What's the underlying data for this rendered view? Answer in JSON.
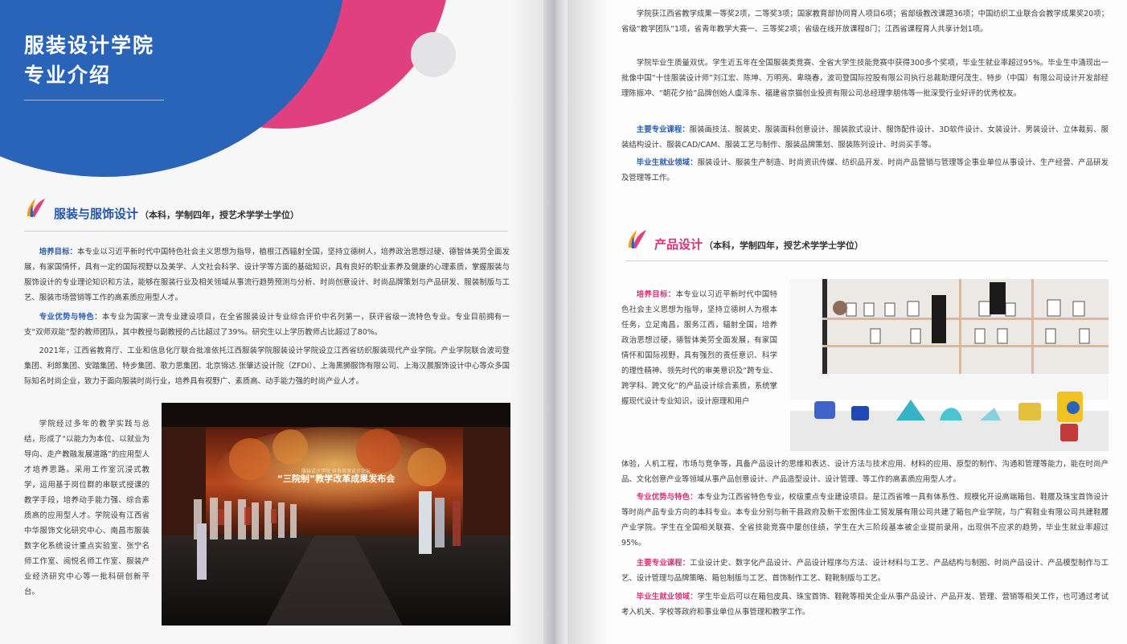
{
  "header": {
    "line1": "服装设计学院",
    "line2": "专业介绍"
  },
  "fashion": {
    "title": "服装与服饰设计",
    "subtitle": "（本科，学制四年，授艺术学学士学位）",
    "p1_label": "培养目标：",
    "p1": "本专业以习近平新时代中国特色社会主义思想为指导，植根江西辐射全国，坚持立德树人，培养政治思想过硬、德智体美劳全面发展，有家国情怀，具有一定的国际视野以及美学、人文社会科学、设计学等方面的基础知识，具有良好的职业素养及健康的心理素质，掌握服装与服饰设计的专业理论知识和方法，能够在服装行业及相关领域从事流行趋势预测与分析、时尚创意设计、时尚品牌策划与产品研发、服装制版与工艺、服装市场营销等工作的高素质应用型人才。",
    "p2_label": "专业优势与特色：",
    "p2": "本专业为国家一流专业建设项目，在全省服装设计专业综合评价中名列第一，获评省级一流特色专业。专业目前拥有一支“双师双能”型的教师团队，其中教授与副教授的占比超过了39%。研究生以上学历教师占比超过了80%。",
    "p3": "2021年，江西省教育厅、工业和信息化厅联合批准依托江西服装学院服装设计学院设立江西省纺织服装现代产业学院。产业学院联合波司登集团、利郎集团、安踏集团、特步集团、歌力思集团、北京锦达.张肇达设计院（ZFDI）、上海黑狮服饰有限公司、上海汉晨服饰设计中心等众多国际知名时尚企业，致力于面向服装时尚行业，培养具有视野广、素质高、动手能力强的时尚产业人才。",
    "p4": "学院经过多年的教学实践与总结，形成了“以能力为本位、以就业为导向、走产教融发展道路”的应用型人才培养思路。采用工作室沉浸式教学，运用基于岗位群的串联式授课的教学手段，培养动手能力强、综合素质高的应用型人才。学院设有江西省中华服饰文化研究中心、南昌市服装数字化系统设计重点实验室、张宁名师工作室、阅悦名师工作室、服装产业经济研究中心等一批科研创新平台。",
    "photo_banner_small": "服装设计学院  财务首席设计论坛",
    "photo_banner": "“三院制”教学改革成果发布会"
  },
  "right_top": {
    "p1": "学院获江西省教学成果一等奖2项，二等奖3项；国家教育部协同育人项目6项；省部级教改课题36项；中国纺织工业联合会教学成果奖20项；省级“教学团队”1项，省青年教学大赛一、三等奖2项；省级在线开放课程8门；江西省课程育人共享计划1项。",
    "p2": "学院毕业生质量双优。学生近五年在全国服装类竞赛、全省大学生技能竞赛中获得300多个奖项，毕业生就业率超过95%。毕业生中涌现出一批像中国“十佳服装设计师”刘江宏、陈坤、万明亮、卑晓春，波司登国际控股有限公司执行总裁助理何茂生、特步（中国）有限公司设计开发部经理陈振冲、“朝花夕拾”品牌创始人虞泽东、福建省京猫创业投资有限公司总经理李朋伟等一批深受行业好评的优秀校友。",
    "p3_label": "主要专业课程：",
    "p3": "服装画技法、服装史、服装面料创意设计、服装款式设计、服饰配件设计、3D软件设计、女装设计、男装设计、立体裁剪、服装结构设计、服装CAD/CAM、服装工艺与制作、服装品牌策划、服装陈列设计、时尚买手等。",
    "p4_label": "毕业生就业领域：",
    "p4": "服装设计、服装生产制造、时尚资讯传媒、纺织品开发、时尚产品营销与管理等企事业单位从事设计、生产经营、产品研发及管理等工作。"
  },
  "product": {
    "title": "产品设计",
    "subtitle": "（本科，学制四年，授艺术学学士学位）",
    "p1_label": "培养目标：",
    "p1_side": "本专业以习近平新时代中国特色社会主义思想为指导，坚持立德树人为根本任务，立足南昌，服务江西，辐射全国，培养政治思想过硬，德智体美劳全面发展，有家国情怀和国际视野，具有强烈的责任意识、科学的理性精神、领先时代的审美意识及“跨专业、跨学科、跨文化”的产品设计综合素质，系统掌握现代设计专业知识，设计原理和用户",
    "p1_rest": "体验，人机工程，市场与竞争等，具备产品设计的思维和表达、设计方法与技术应用、材料的应用、原型的制作、沟通和管理等能力，能在时尚产品、文化创意产业等领域从事产品创意设计、产品造型设计、设计管理、等工作的高素质应用型人才。",
    "p2_label": "专业优势与特色：",
    "p2": "本专业为江西省特色专业，校级重点专业建设项目。是江西省唯一具有体系性、规模化开设高端箱包、鞋履及珠宝首饰设计等时尚产品专业方向的本科专业。本专业分别与新干县政府及新干宏图伟业工贸发展有限公司共建了箱包产业学院，与广宥鞋业有限公司共建鞋履产业学院。学生在全国相关联赛、全省技能竞赛中屡创佳绩，学生在大三阶段基本被企业提前录用，出现供不应求的趋势，毕业生就业率超过95%。",
    "p3_label": "主要专业课程：",
    "p3": "工业设计史、数字化产品设计、产品设计程序与方法、设计材料与工艺、产品结构与制图、时尚产品设计、产品模型制作与工艺、设计管理与品牌策略、箱包制版与工艺、首饰制作工艺、鞋靴制版与工艺。",
    "p4_label": "毕业生就业领域：",
    "p4": "学生毕业后可以在箱包皮具、珠宝首饰、鞋靴等相关企业从事产品设计、产品开发、管理、营销等相关工作，也可通过考试考入机关、学校等政府和事业单位从事管理和教学工作。"
  },
  "colors": {
    "blue": "#2a64b8",
    "pink": "#e0407f",
    "label_blue": "#2b5fb0",
    "label_pink": "#d9347a"
  }
}
